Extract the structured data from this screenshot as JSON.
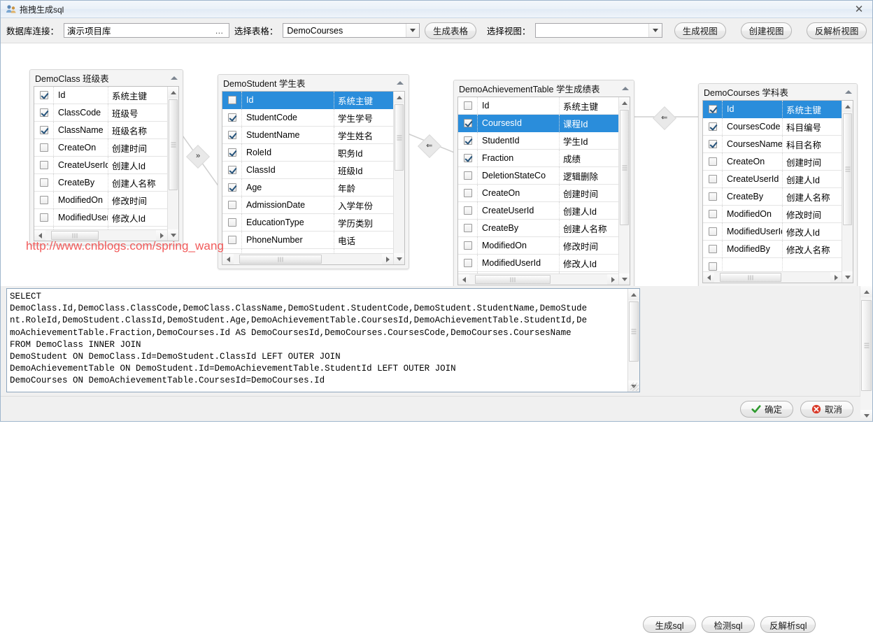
{
  "window": {
    "title": "拖拽生成sql",
    "app_icon": "people-icon",
    "close_label": "✕"
  },
  "toolbar": {
    "conn_label": "数据库连接：",
    "conn_value": "演示项目库",
    "conn_ellipsis": "…",
    "table_label": "选择表格：",
    "table_value": "DemoCourses",
    "gen_table_btn": "生成表格",
    "view_label": "选择视图：",
    "view_value": "",
    "gen_view_btn": "生成视图",
    "create_view_btn": "创建视图",
    "parse_view_btn": "反解析视图"
  },
  "watermark": "http://www.cnblogs.com/spring_wang",
  "tables": [
    {
      "id": "democlass",
      "title": "DemoClass 班级表",
      "columns": [
        {
          "checked": true,
          "name": "Id",
          "desc": "系统主键",
          "selected": false
        },
        {
          "checked": true,
          "name": "ClassCode",
          "desc": "班级号",
          "selected": false
        },
        {
          "checked": true,
          "name": "ClassName",
          "desc": "班级名称",
          "selected": false
        },
        {
          "checked": false,
          "name": "CreateOn",
          "desc": "创建时间",
          "selected": false
        },
        {
          "checked": false,
          "name": "CreateUserId",
          "desc": "创建人Id",
          "selected": false
        },
        {
          "checked": false,
          "name": "CreateBy",
          "desc": "创建人名称",
          "selected": false
        },
        {
          "checked": false,
          "name": "ModifiedOn",
          "desc": "修改时间",
          "selected": false
        },
        {
          "checked": false,
          "name": "ModifiedUserId",
          "desc": "修改人Id",
          "selected": false
        }
      ]
    },
    {
      "id": "demostudent",
      "title": "DemoStudent 学生表",
      "columns": [
        {
          "checked": false,
          "name": "Id",
          "desc": "系统主键",
          "selected": true
        },
        {
          "checked": true,
          "name": "StudentCode",
          "desc": "学生学号",
          "selected": false
        },
        {
          "checked": true,
          "name": "StudentName",
          "desc": "学生姓名",
          "selected": false
        },
        {
          "checked": true,
          "name": "RoleId",
          "desc": "职务Id",
          "selected": false
        },
        {
          "checked": true,
          "name": "ClassId",
          "desc": "班级Id",
          "selected": false
        },
        {
          "checked": true,
          "name": "Age",
          "desc": "年龄",
          "selected": false
        },
        {
          "checked": false,
          "name": "AdmissionDate",
          "desc": "入学年份",
          "selected": false
        },
        {
          "checked": false,
          "name": "EducationType",
          "desc": "学历类别",
          "selected": false
        },
        {
          "checked": false,
          "name": "PhoneNumber",
          "desc": "电话",
          "selected": false
        }
      ]
    },
    {
      "id": "demoachievementtable",
      "title": "DemoAchievementTable 学生成绩表",
      "columns": [
        {
          "checked": false,
          "name": "Id",
          "desc": "系统主键",
          "selected": false
        },
        {
          "checked": true,
          "name": "CoursesId",
          "desc": "课程Id",
          "selected": true
        },
        {
          "checked": true,
          "name": "StudentId",
          "desc": "学生Id",
          "selected": false
        },
        {
          "checked": true,
          "name": "Fraction",
          "desc": "成绩",
          "selected": false
        },
        {
          "checked": false,
          "name": "DeletionStateCo",
          "desc": "逻辑删除",
          "selected": false
        },
        {
          "checked": false,
          "name": "CreateOn",
          "desc": "创建时间",
          "selected": false
        },
        {
          "checked": false,
          "name": "CreateUserId",
          "desc": "创建人Id",
          "selected": false
        },
        {
          "checked": false,
          "name": "CreateBy",
          "desc": "创建人名称",
          "selected": false
        },
        {
          "checked": false,
          "name": "ModifiedOn",
          "desc": "修改时间",
          "selected": false
        },
        {
          "checked": false,
          "name": "ModifiedUserId",
          "desc": "修改人Id",
          "selected": false
        }
      ]
    },
    {
      "id": "democourses",
      "title": "DemoCourses 学科表",
      "columns": [
        {
          "checked": true,
          "name": "Id",
          "desc": "系统主键",
          "selected": true
        },
        {
          "checked": true,
          "name": "CoursesCode",
          "desc": "科目编号",
          "selected": false
        },
        {
          "checked": true,
          "name": "CoursesName",
          "desc": "科目名称",
          "selected": false
        },
        {
          "checked": false,
          "name": "CreateOn",
          "desc": "创建时间",
          "selected": false
        },
        {
          "checked": false,
          "name": "CreateUserId",
          "desc": "创建人Id",
          "selected": false
        },
        {
          "checked": false,
          "name": "CreateBy",
          "desc": "创建人名称",
          "selected": false
        },
        {
          "checked": false,
          "name": "ModifiedOn",
          "desc": "修改时间",
          "selected": false
        },
        {
          "checked": false,
          "name": "ModifiedUserId",
          "desc": "修改人Id",
          "selected": false
        },
        {
          "checked": false,
          "name": "ModifiedBy",
          "desc": "修改人名称",
          "selected": false
        }
      ]
    }
  ],
  "connectors": [
    {
      "id": "democlass-demostudent",
      "glyph": "»"
    },
    {
      "id": "demostudent-demoachievement",
      "glyph": "⇐"
    },
    {
      "id": "demoachievement-democourses",
      "glyph": "⇐"
    }
  ],
  "sql": {
    "text": "SELECT\nDemoClass.Id,DemoClass.ClassCode,DemoClass.ClassName,DemoStudent.StudentCode,DemoStudent.StudentName,DemoStude\nnt.RoleId,DemoStudent.ClassId,DemoStudent.Age,DemoAchievementTable.CoursesId,DemoAchievementTable.StudentId,De\nmoAchievementTable.Fraction,DemoCourses.Id AS DemoCoursesId,DemoCourses.CoursesCode,DemoCourses.CoursesName\nFROM DemoClass INNER JOIN\nDemoStudent ON DemoClass.Id=DemoStudent.ClassId LEFT OUTER JOIN\nDemoAchievementTable ON DemoStudent.Id=DemoAchievementTable.StudentId LEFT OUTER JOIN\nDemoCourses ON DemoAchievementTable.CoursesId=DemoCourses.Id",
    "gen_sql_btn": "生成sql",
    "check_sql_btn": "检测sql",
    "parse_sql_btn": "反解析sql"
  },
  "footer": {
    "ok_btn": "确定",
    "cancel_btn": "取消"
  }
}
